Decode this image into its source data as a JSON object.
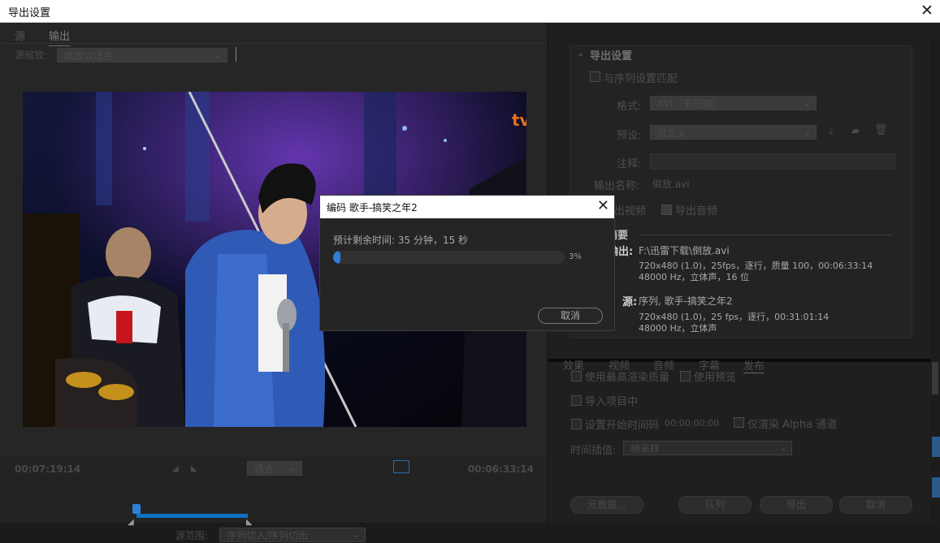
{
  "window": {
    "title": "导出设置",
    "close": "✕"
  },
  "left": {
    "tabs": [
      {
        "label": "源"
      },
      {
        "label": "输出"
      }
    ],
    "scale_label": "源缩放:",
    "scale_value": "缩放以适合",
    "timeline": {
      "tc_left": "00:07:19:14",
      "tc_right": "00:06:33:14",
      "fit_value": "适合",
      "range_label": "源范围:",
      "range_value": "序列切入/序列切出"
    },
    "preview": {
      "logo": "tv"
    }
  },
  "right": {
    "section_title": "导出设置",
    "match_sequence": "与序列设置匹配",
    "format_label": "格式:",
    "format_value": "AVI（未压缩）",
    "preset_label": "预设:",
    "preset_value": "自定义",
    "comment_label": "注释:",
    "output_name_label": "输出名称:",
    "output_name_value": "倒放.avi",
    "export_video": "导出视频",
    "export_audio": "导出音频",
    "summary_title": "摘要",
    "summary": {
      "output_label": "输出:",
      "output_path": "F:\\迅雷下载\\倒放.avi",
      "output_line2": "720x480 (1.0)，25fps，逐行，质量 100，00:06:33:14",
      "output_line3": "48000 Hz，立体声，16 位",
      "source_label": "源:",
      "source_line1": "序列, 歌手-搞笑之年2",
      "source_line2": "720x480 (1.0)，25 fps，逐行，00:31:01:14",
      "source_line3": "48000 Hz，立体声"
    },
    "tabs": [
      "效果",
      "视频",
      "音频",
      "字幕",
      "发布"
    ],
    "options": {
      "max_render": "使用最高渲染质量",
      "use_preview": "使用预览",
      "import_project": "导入项目中",
      "set_start_tc": "设置开始时间码",
      "start_tc_value": "00:00:00:00",
      "render_alpha": "仅渲染 Alpha 通道",
      "interp_label": "时间插值:",
      "interp_value": "帧采样"
    },
    "buttons": {
      "metadata": "元数据...",
      "queue": "队列",
      "export": "导出",
      "cancel": "取消"
    }
  },
  "dialog": {
    "title": "编码 歌手-搞笑之年2",
    "close": "✕",
    "eta": "预计剩余时间: 35 分钟，15 秒",
    "progress_text": "3%",
    "progress_value": 0.03,
    "cancel": "取消"
  },
  "colors": {
    "accent": "#2e7fd9",
    "bg": "#1b1b1b"
  }
}
